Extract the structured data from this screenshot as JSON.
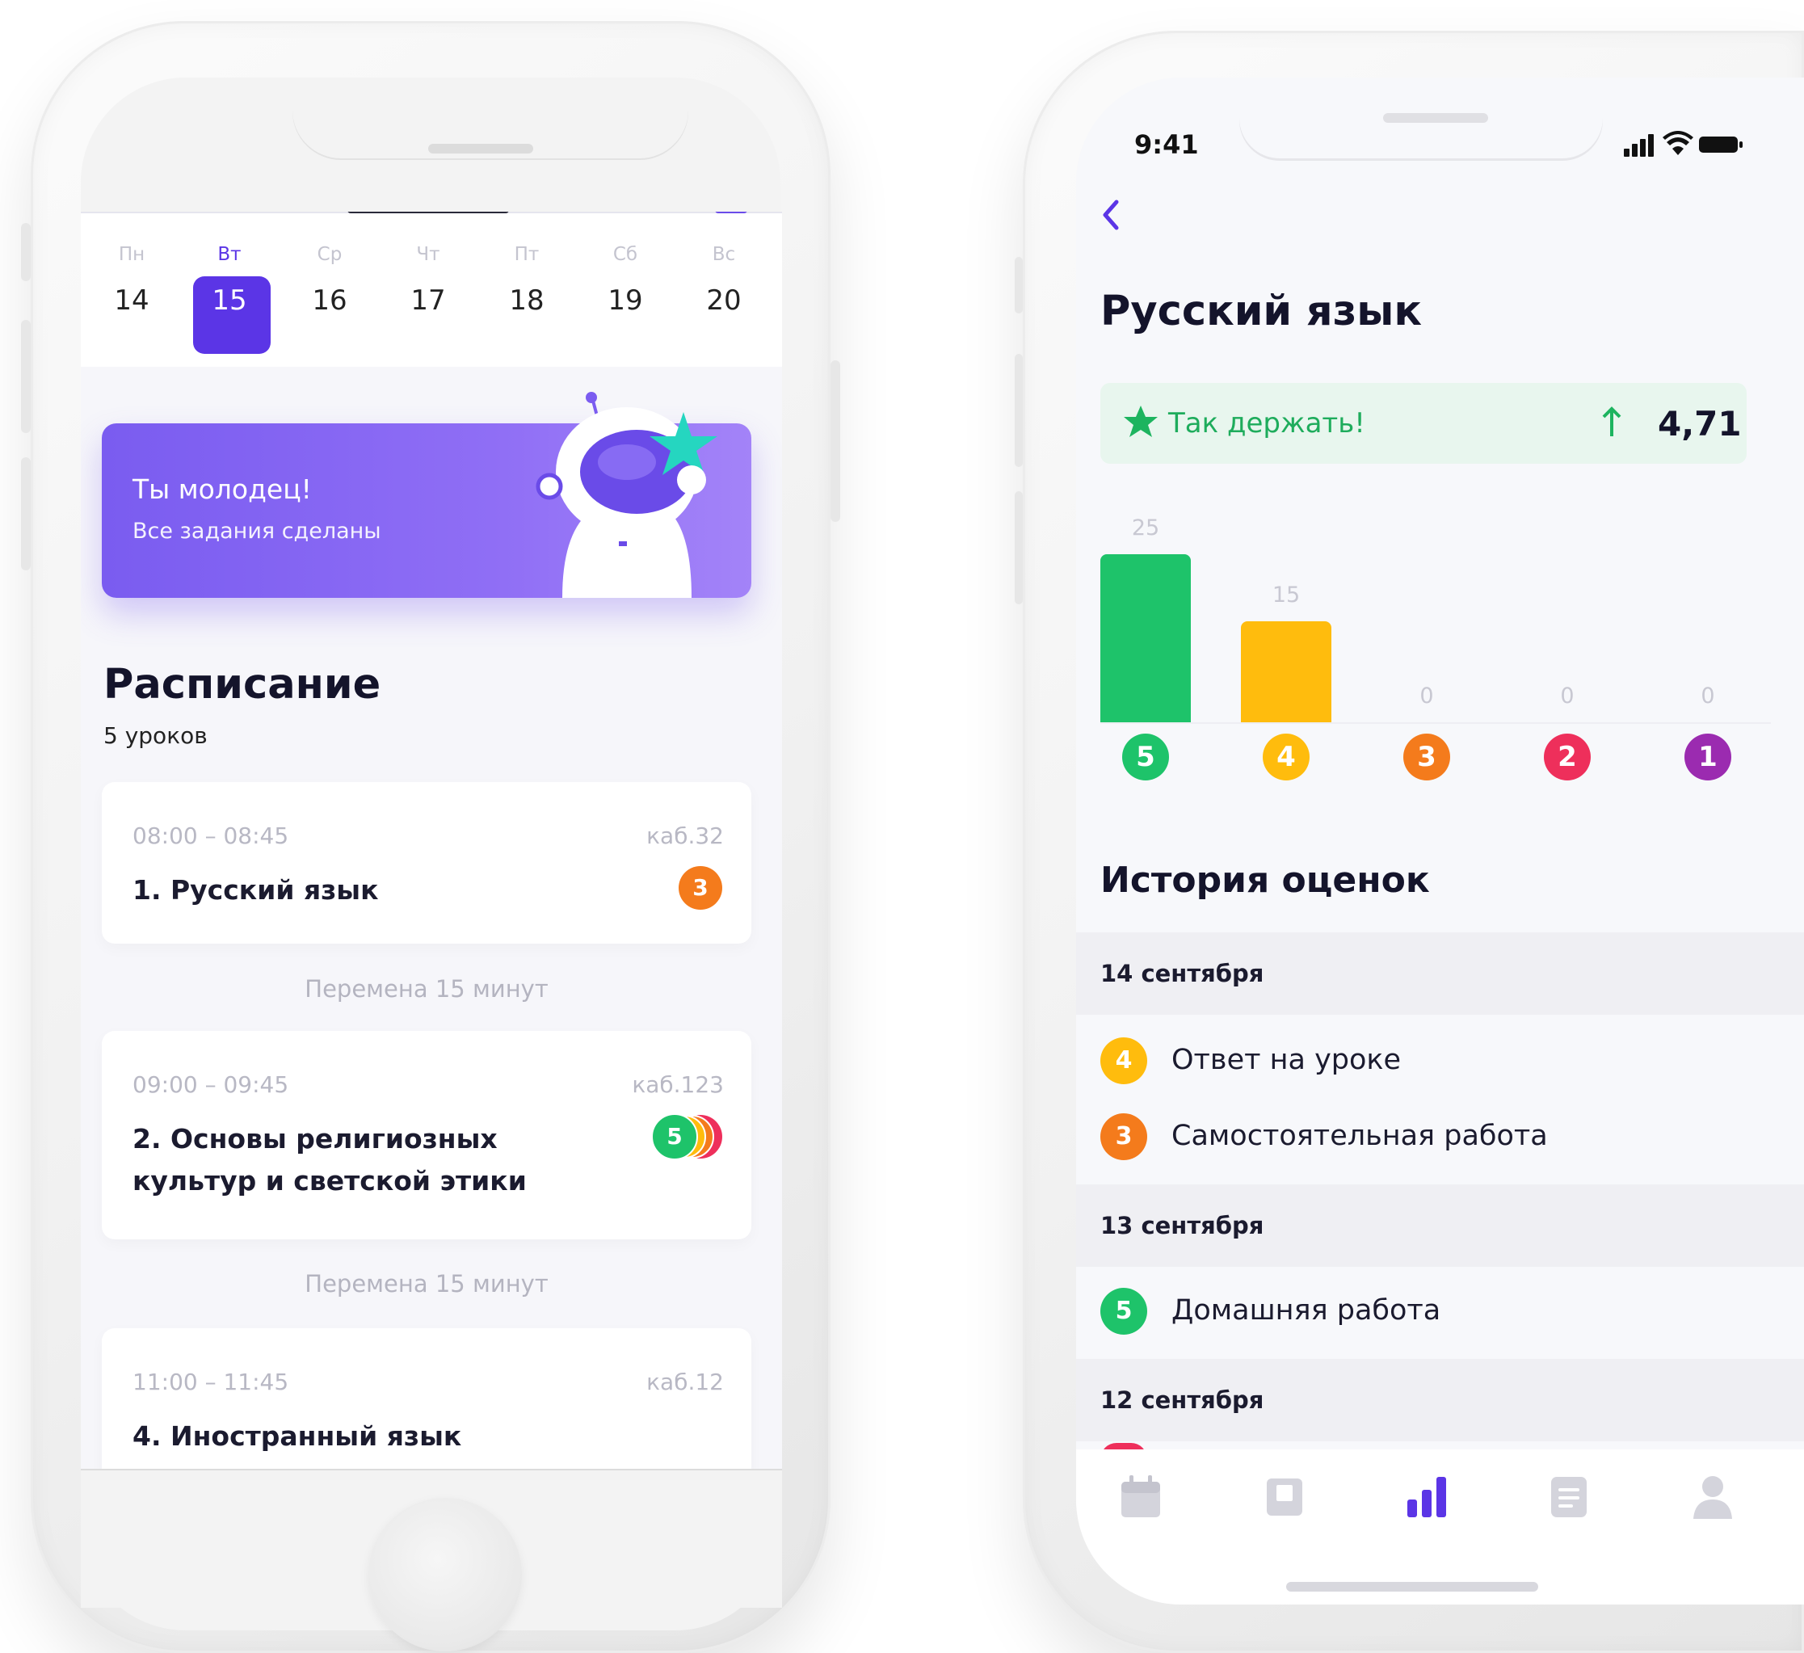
{
  "left_phone": {
    "week": [
      {
        "name": "Пн",
        "num": "14",
        "selected": false
      },
      {
        "name": "Вт",
        "num": "15",
        "selected": true
      },
      {
        "name": "Ср",
        "num": "16",
        "selected": false
      },
      {
        "name": "Чт",
        "num": "17",
        "selected": false
      },
      {
        "name": "Пт",
        "num": "18",
        "selected": false
      },
      {
        "name": "Сб",
        "num": "19",
        "selected": false
      },
      {
        "name": "Вс",
        "num": "20",
        "selected": false
      }
    ],
    "banner": {
      "title": "Ты молодец!",
      "subtitle": "Все задания сделаны"
    },
    "schedule": {
      "title": "Расписание",
      "subtitle": "5 уроков",
      "lessons": [
        {
          "time": "08:00 – 08:45",
          "room": "каб.32",
          "subject": "1. Русский язык",
          "grades": [
            "3"
          ]
        },
        {
          "time": "09:00 – 09:45",
          "room": "каб.123",
          "subject": "2. Основы религиозных культур и светской этики",
          "grades": [
            "5"
          ]
        },
        {
          "time": "11:00 – 11:45",
          "room": "каб.12",
          "subject": "4. Иностранный язык",
          "grades": []
        }
      ],
      "break_label_1": "Перемена 15 минут",
      "break_label_2": "Перемена 15 минут"
    }
  },
  "right_phone": {
    "status_time": "9:41",
    "back_icon": "chevron-left-icon",
    "title": "Русский язык",
    "average": {
      "message": "Так держать!",
      "value": "4,71"
    },
    "chart_data": {
      "type": "bar",
      "categories": [
        "5",
        "4",
        "3",
        "2",
        "1"
      ],
      "values": [
        25,
        15,
        0,
        0,
        0
      ],
      "colors": [
        "#1ec36a",
        "#ffbc0d",
        "#f47b1c",
        "#ee2f5b",
        "#9b2bb0"
      ],
      "ylim": [
        0,
        25
      ]
    },
    "history": {
      "title": "История оценок",
      "groups": [
        {
          "date": "14 сентября",
          "items": [
            {
              "grade": "4",
              "text": "Ответ на уроке"
            },
            {
              "grade": "3",
              "text": "Самостоятельная работа"
            }
          ]
        },
        {
          "date": "13 сентября",
          "items": [
            {
              "grade": "5",
              "text": "Домашняя работа"
            }
          ]
        },
        {
          "date": "12 сентября",
          "items": []
        }
      ]
    },
    "tabs": [
      {
        "icon": "calendar-icon",
        "active": false
      },
      {
        "icon": "diary-icon",
        "active": false
      },
      {
        "icon": "chart-icon",
        "active": true
      },
      {
        "icon": "document-icon",
        "active": false
      },
      {
        "icon": "profile-icon",
        "active": false
      }
    ]
  },
  "colors": {
    "accent": "#5b35e6",
    "grade_5": "#1ec36a",
    "grade_4": "#ffbc0d",
    "grade_3": "#f47b1c",
    "grade_2": "#ee2f5b",
    "grade_1": "#9b2bb0",
    "success_bg": "#e8f6ee"
  }
}
